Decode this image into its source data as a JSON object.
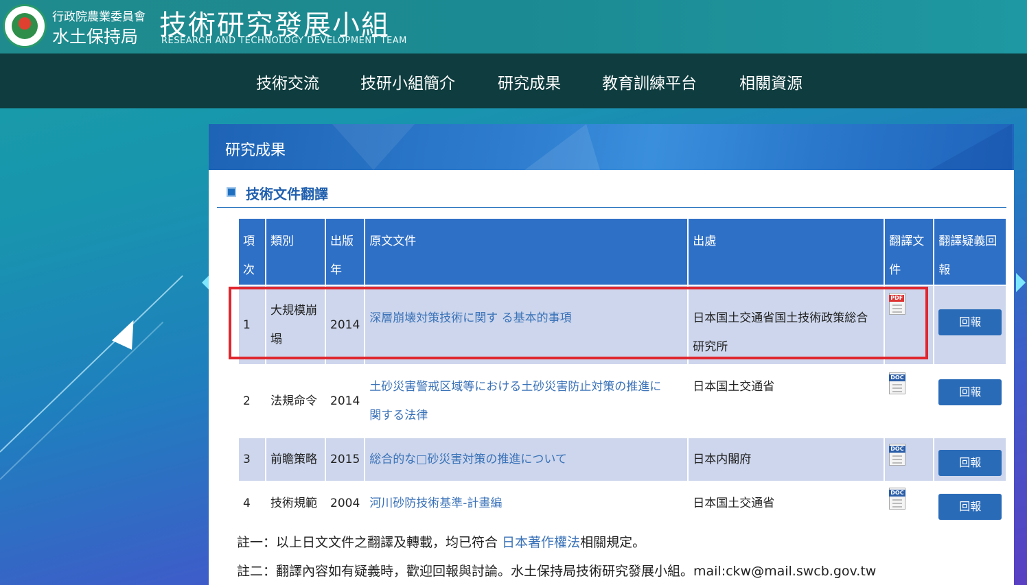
{
  "header": {
    "org_line1": "行政院農業委員會",
    "org_line2": "水土保持局",
    "team_title": "技術研究發展小組",
    "team_subtitle": "RESEARCH AND TECHNOLOGY DEVELOPMENT TEAM"
  },
  "nav": {
    "items": [
      "技術交流",
      "技研小組簡介",
      "研究成果",
      "教育訓練平台",
      "相關資源"
    ]
  },
  "panel": {
    "title": "研究成果",
    "section_title": "技術文件翻譯"
  },
  "table": {
    "headers": {
      "index": [
        "項",
        "次"
      ],
      "category": "類別",
      "year": [
        "出版",
        "年"
      ],
      "original": "原文文件",
      "source": "出處",
      "translation": [
        "翻譯文",
        "件"
      ],
      "feedback": [
        "翻譯疑義回",
        "報"
      ]
    },
    "rows": [
      {
        "index": "1",
        "category": [
          "大規模崩",
          "塌"
        ],
        "year": "2014",
        "original": [
          "深層崩壊対策技術に関す る基本的事項"
        ],
        "source": [
          "日本国土交通省国土技術政策総合",
          "研究所"
        ],
        "file_type": "PDF",
        "feedback": "回報"
      },
      {
        "index": "2",
        "category": [
          "法規命令"
        ],
        "year": "2014",
        "original": [
          "土砂災害警戒区域等における土砂災害防止対策の推進に",
          "関する法律"
        ],
        "source": [
          "日本国土交通省"
        ],
        "file_type": "DOC",
        "feedback": "回報"
      },
      {
        "index": "3",
        "category": [
          "前瞻策略"
        ],
        "year": "2015",
        "original": [
          "総合的な□砂災害対策の推進について"
        ],
        "source": [
          "日本内閣府"
        ],
        "file_type": "DOC",
        "feedback": "回報"
      },
      {
        "index": "4",
        "category": [
          "技術規範"
        ],
        "year": "2004",
        "original": [
          "河川砂防技術基準-計畫編"
        ],
        "source": [
          "日本国土交通省"
        ],
        "file_type": "DOC",
        "feedback": "回報"
      }
    ]
  },
  "notes": {
    "note1_prefix": "註一：以上日文文件之翻譯及轉載，均已符合 ",
    "note1_link": "日本著作權法",
    "note1_suffix": "相關規定。",
    "note2": "註二：翻譯內容如有疑義時，歡迎回報與討論。水土保持局技術研究發展小組。mail:ckw@mail.swcb.gov.tw"
  },
  "colors": {
    "nav_bg": "#0f3c3e",
    "header_bg": "#1f8b8e",
    "table_header": "#2f70c7",
    "row_odd": "#cdd6ec",
    "link": "#3a72b8",
    "button": "#2a6bb8",
    "highlight": "#e0262e"
  }
}
